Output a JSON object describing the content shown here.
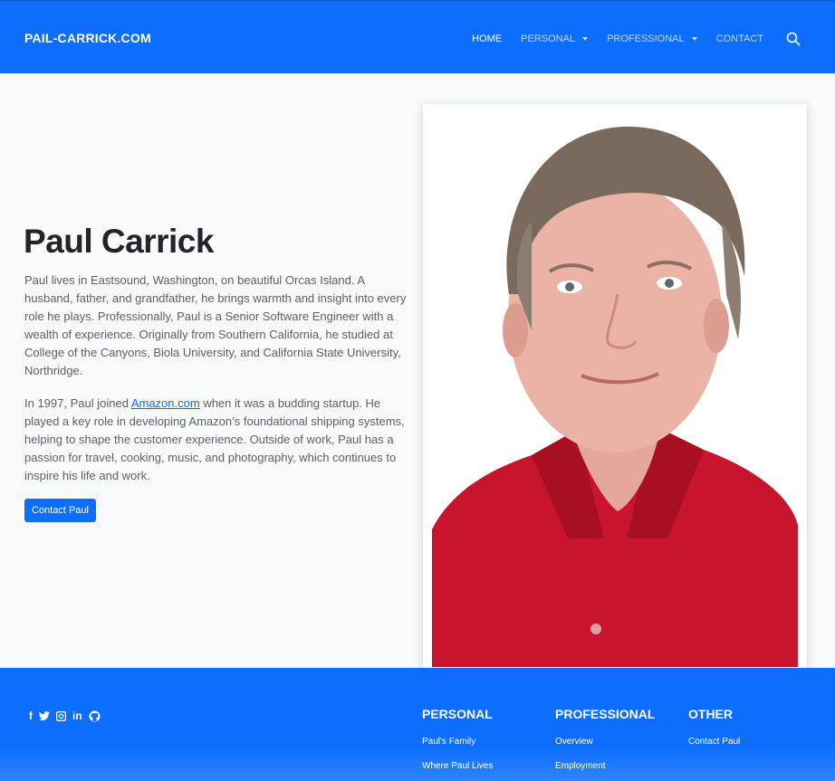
{
  "header": {
    "brand": "PAIL-CARRICK.COM",
    "nav": [
      {
        "label": "HOME"
      },
      {
        "label": "PERSONAL"
      },
      {
        "label": "PROFESSIONAL"
      },
      {
        "label": "CONTACT"
      }
    ],
    "search_icon": "search-icon"
  },
  "hero": {
    "title": "Paul Carrick",
    "p1": "Paul lives in Eastsound, Washington, on beautiful Orcas Island. A husband, father, and grandfather, he brings warmth and insight into every role he plays. Professionally, Paul is a Senior Software Engineer with a wealth of experience. Originally from Southern California, he studied at College of the Canyons, Biola University, and California State University, Northridge.",
    "p2_before": "In 1997, Paul joined ",
    "p2_link": "Amazon.com",
    "p2_after": " when it was a budding startup. He played a key role in developing Amazon’s foundational shipping systems, helping to shape the customer experience. Outside of work, Paul has a passion for travel, cooking, music, and photography, which continues to inspire his life and work.",
    "button": "Contact Paul",
    "photo_icon": "portrait-photo"
  },
  "footer": {
    "socials": [
      "facebook-icon",
      "twitter-icon",
      "instagram-icon",
      "linkedin-icon",
      "github-icon"
    ],
    "personal": {
      "heading": "PERSONAL",
      "links": [
        "Paul's Family",
        "Where Paul Lives"
      ]
    },
    "professional": {
      "heading": "PROFESSIONAL",
      "links": [
        "Overview",
        "Employment"
      ]
    },
    "other": {
      "heading": "OTHER",
      "links": [
        "Contact Paul"
      ]
    }
  },
  "colors": {
    "primary": "#0d6efd",
    "background": "#f8f9fa",
    "shirt": "#c8142c"
  }
}
